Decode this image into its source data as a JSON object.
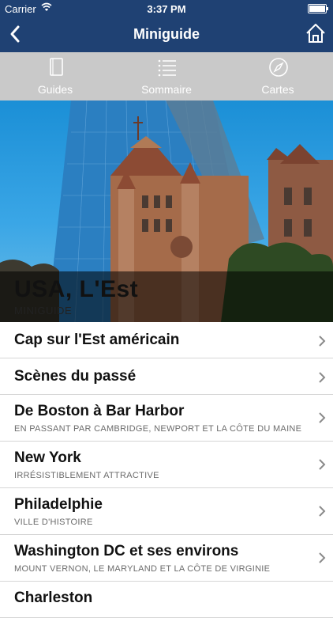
{
  "status": {
    "carrier": "Carrier",
    "time": "3:37 PM"
  },
  "nav": {
    "title": "Miniguide"
  },
  "tabs": [
    {
      "label": "Guides"
    },
    {
      "label": "Sommaire"
    },
    {
      "label": "Cartes"
    }
  ],
  "hero": {
    "title": "USA, L'Est",
    "subtitle": "MINIGUIDE"
  },
  "list": [
    {
      "title": "Cap sur l'Est américain",
      "subtitle": ""
    },
    {
      "title": "Scènes du passé",
      "subtitle": ""
    },
    {
      "title": "De Boston à Bar Harbor",
      "subtitle": "EN PASSANT PAR CAMBRIDGE, NEWPORT ET LA CÔTE DU MAINE"
    },
    {
      "title": "New York",
      "subtitle": "IRRÉSISTIBLEMENT ATTRACTIVE"
    },
    {
      "title": "Philadelphie",
      "subtitle": "VILLE D'HISTOIRE"
    },
    {
      "title": "Washington DC et ses environs",
      "subtitle": "MOUNT VERNON, LE MARYLAND ET LA CÔTE DE VIRGINIE"
    },
    {
      "title": "Charleston",
      "subtitle": ""
    }
  ]
}
